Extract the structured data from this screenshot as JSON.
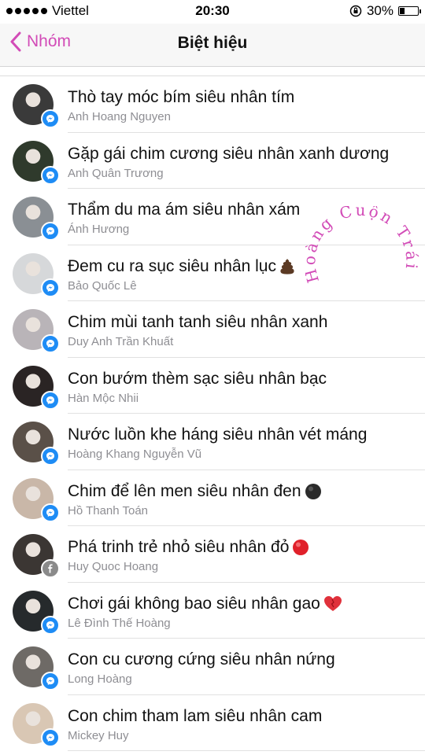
{
  "status_bar": {
    "carrier": "Viettel",
    "time": "20:30",
    "battery": "30%",
    "battery_level": 0.3
  },
  "nav": {
    "back_label": "Nhóm",
    "title": "Biệt hiệu"
  },
  "rows": [
    {
      "nickname": "Thò tay móc bím siêu nhân tím",
      "name": "Anh Hoang Nguyen",
      "badge": "messenger",
      "avatar_color": "#3a3a3a"
    },
    {
      "nickname": "Gặp gái chim cương siêu nhân xanh dương",
      "name": "Anh Quân Trương",
      "badge": "messenger",
      "avatar_color": "#2f3a2c"
    },
    {
      "nickname": "Thẩm du ma ám siêu nhân xám",
      "name": "Ánh Hương",
      "badge": "messenger",
      "avatar_color": "#8a8f94"
    },
    {
      "nickname": "Đem cu ra sục siêu nhân lục",
      "name": "Bảo Quốc Lê",
      "badge": "messenger",
      "emoji": "poop",
      "avatar_color": "#d6d8da"
    },
    {
      "nickname": "Chim mùi tanh tanh siêu nhân xanh",
      "name": "Duy Anh Trần Khuất",
      "badge": "messenger",
      "avatar_color": "#b9b4b8"
    },
    {
      "nickname": "Con bướm thèm sạc siêu nhân bạc",
      "name": "Hàn Mộc Nhii",
      "badge": "messenger",
      "avatar_color": "#2a2424"
    },
    {
      "nickname": "Nước luồn khe háng siêu nhân vét máng",
      "name": "Hoàng Khang Nguyễn Vũ",
      "badge": "messenger",
      "avatar_color": "#5a5048"
    },
    {
      "nickname": "Chim để lên men siêu nhân đen",
      "name": "Hồ Thanh Toán",
      "badge": "messenger",
      "emoji": "black-circle",
      "avatar_color": "#c9b7a8"
    },
    {
      "nickname": "Phá trinh trẻ nhỏ siêu nhân đỏ",
      "name": "Huy Quoc Hoang",
      "badge": "facebook",
      "emoji": "red-circle",
      "avatar_color": "#3b3633"
    },
    {
      "nickname": "Chơi gái không bao siêu nhân gao",
      "name": "Lê Đình Thế Hoàng",
      "badge": "messenger",
      "emoji": "heart",
      "avatar_color": "#262a2c"
    },
    {
      "nickname": "Con cu cương cứng siêu nhân nứng",
      "name": "Long Hoàng",
      "badge": "messenger",
      "avatar_color": "#6e6a66"
    },
    {
      "nickname": "Con chim tham lam siêu nhân cam",
      "name": "Mickey Huy",
      "badge": "messenger",
      "avatar_color": "#d9c7b4"
    }
  ],
  "watermark": {
    "text": "Hoàng Cuộn Trái",
    "color": "#d24bb7"
  }
}
